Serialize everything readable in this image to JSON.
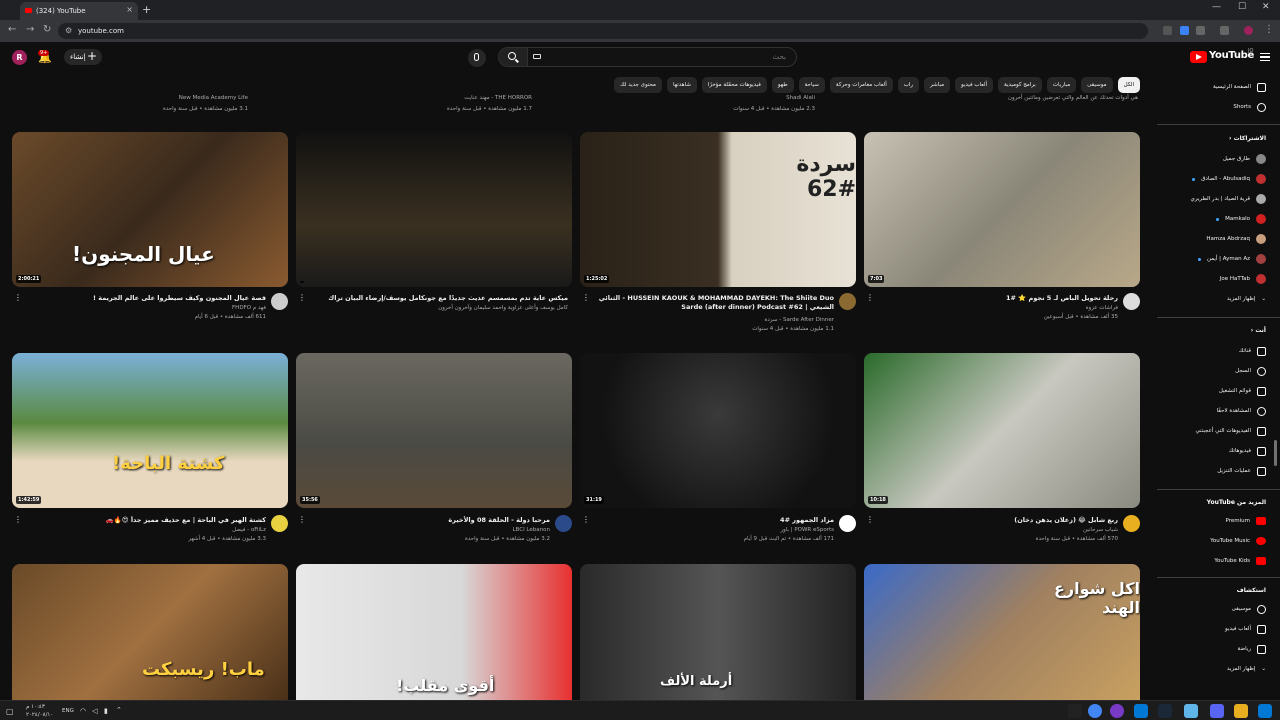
{
  "browser": {
    "tab_title": "(324) YouTube",
    "url": "youtube.com",
    "new_tab": "+",
    "tab_close": "×",
    "min": "—",
    "max": "☐",
    "close": "✕"
  },
  "header": {
    "avatar_letter": "R",
    "notification_count": "9+",
    "create_label": "إنشاء",
    "search_placeholder": "بحث",
    "logo_text": "YouTube",
    "logo_sup": "JO"
  },
  "chips": [
    "الكل",
    "موسيقى",
    "مباريات",
    "برامج كوميدية",
    "ألعاب فيديو",
    "مباشر",
    "راب",
    "ألعاب مغامرات وحركة",
    "سياحة",
    "طهو",
    "فيديوهات محمّلة مؤخرًا",
    "شاهدتها",
    "محتوى جديد لك"
  ],
  "sidebar": {
    "home": "الصفحة الرئيسية",
    "shorts": "Shorts",
    "subscriptions_head": "الاشتراكات",
    "subscriptions": [
      "طارق جميل",
      "Abulsadiq - الصادق",
      "قرية الصياد | بدر الطريري",
      "Mamkalo",
      "Hamza Abdrzaq",
      "Ayman Az | أيمن",
      "Joe HaTTab"
    ],
    "show_more": "إظهار المزيد",
    "you_head": "أنت",
    "you_items": [
      "قناتك",
      "السجل",
      "قوائم التشغيل",
      "المشاهدة لاحقًا",
      "الفيديوهات التي أعجبتني",
      "فيديوهاتك",
      "عمليات التنزيل"
    ],
    "more_from_head": "المزيد من YouTube",
    "more_from_items": [
      "Premium",
      "YouTube Music",
      "YouTube Kids"
    ],
    "explore_head": "استكشاف",
    "explore_items": [
      "موسيقى",
      "ألعاب فيديو",
      "رياضة"
    ],
    "explore_more": "إظهار المزيد"
  },
  "prev_row": [
    {
      "channel": "New Media Academy Life",
      "stats": "3.1 مليون مشاهدة • قبل سنة واحدة"
    },
    {
      "channel": "THE HORROR - مهند عنايت",
      "stats": "1.7 مليون مشاهدة • قبل سنة واحدة"
    },
    {
      "channel": "Shadi Alali",
      "stats": "2.3 مليون مشاهدة • قبل 4 سنوات"
    },
    {
      "channel": "هي أدوات تحدثك عن العالم والتي تعرضين ومائتين أخرون",
      "stats": ""
    }
  ],
  "videos": [
    {
      "title": "قصة عيال المجنون وكيف سيطروا على عالم الجريمة !",
      "channel": "فهد م FHDFO",
      "stats": "611 ألف مشاهدة • قبل 6 أيام",
      "duration": "2:00:21",
      "thumb_text": "عيال المجنون!"
    },
    {
      "title": "ميكس عاية تدم بمسمسم عديث جديدًا مع جونكامل يوسف/إرضاء البيان تراك 2024",
      "channel": "كامل يوسف وأعلى عزاوية واحمد سليمان وآخرون آخرون",
      "stats": "",
      "duration": "",
      "thumb_text": ""
    },
    {
      "title": "HUSSEIN KAOUK & MOHAMMAD DAYEKH: The Shiite Duo - الثنائي الشيعي | Sarde (after dinner) Podcast #62",
      "channel": "Sarde After Dinner - سردة",
      "stats": "1.1 مليون مشاهدة • قبل 4 سنوات",
      "duration": "1:25:02",
      "thumb_text": "سردة #62"
    },
    {
      "title": "رحلة تحويل الباص لـ 5 نجوم ⭐ #1",
      "channel": "فراشات عزوة",
      "stats": "35 ألف مشاهدة • قبل أسبوعين",
      "duration": "7:03",
      "thumb_text": ""
    },
    {
      "title": "كشتة الهبر في الباحة | مع حذيف مميز جداً 😍🔥🚗",
      "channel": "oFiiLz - فيصل",
      "stats": "3.3 مليون مشاهدة • قبل 4 أشهر",
      "duration": "1:42:59",
      "thumb_text": "كشتة الباحة!"
    },
    {
      "title": "مرحبا دولة - الحلقة 08 والأخيرة",
      "channel": "LBCI Lebanon",
      "stats": "3.2 مليون مشاهدة • قبل سنة واحدة",
      "duration": "35:56",
      "thumb_text": ""
    },
    {
      "title": "مزاد الجمهور #4",
      "channel": "POWR eSports | باور",
      "stats": "171 ألف مشاهدة • تم البث قبل 9 أيام",
      "duration": "31:19",
      "thumb_text": ""
    },
    {
      "title": "ربع شابل 😂 (زعلان يدهن دخان)",
      "channel": "شباب سرحانين",
      "stats": "570 ألف مشاهدة • قبل سنة واحدة",
      "duration": "10:18",
      "thumb_text": ""
    },
    {
      "title": "",
      "channel": "",
      "stats": "",
      "duration": "",
      "thumb_text": "ماب! ريسبكت"
    },
    {
      "title": "",
      "channel": "",
      "stats": "",
      "duration": "",
      "thumb_text": "أقوى مقلب!"
    },
    {
      "title": "",
      "channel": "",
      "stats": "",
      "duration": "",
      "thumb_text": "أرملة الألف"
    },
    {
      "title": "",
      "channel": "",
      "stats": "",
      "duration": "",
      "thumb_text": "اكل شوارع الهند"
    }
  ],
  "taskbar": {
    "lang": "ENG",
    "time": "١٠:٤٣ م",
    "date": "٢٠٢٤/٠٨/١٠"
  },
  "colors": {
    "yt_red": "#ff0000",
    "bg": "#0f0f0f",
    "chip": "#272727"
  }
}
